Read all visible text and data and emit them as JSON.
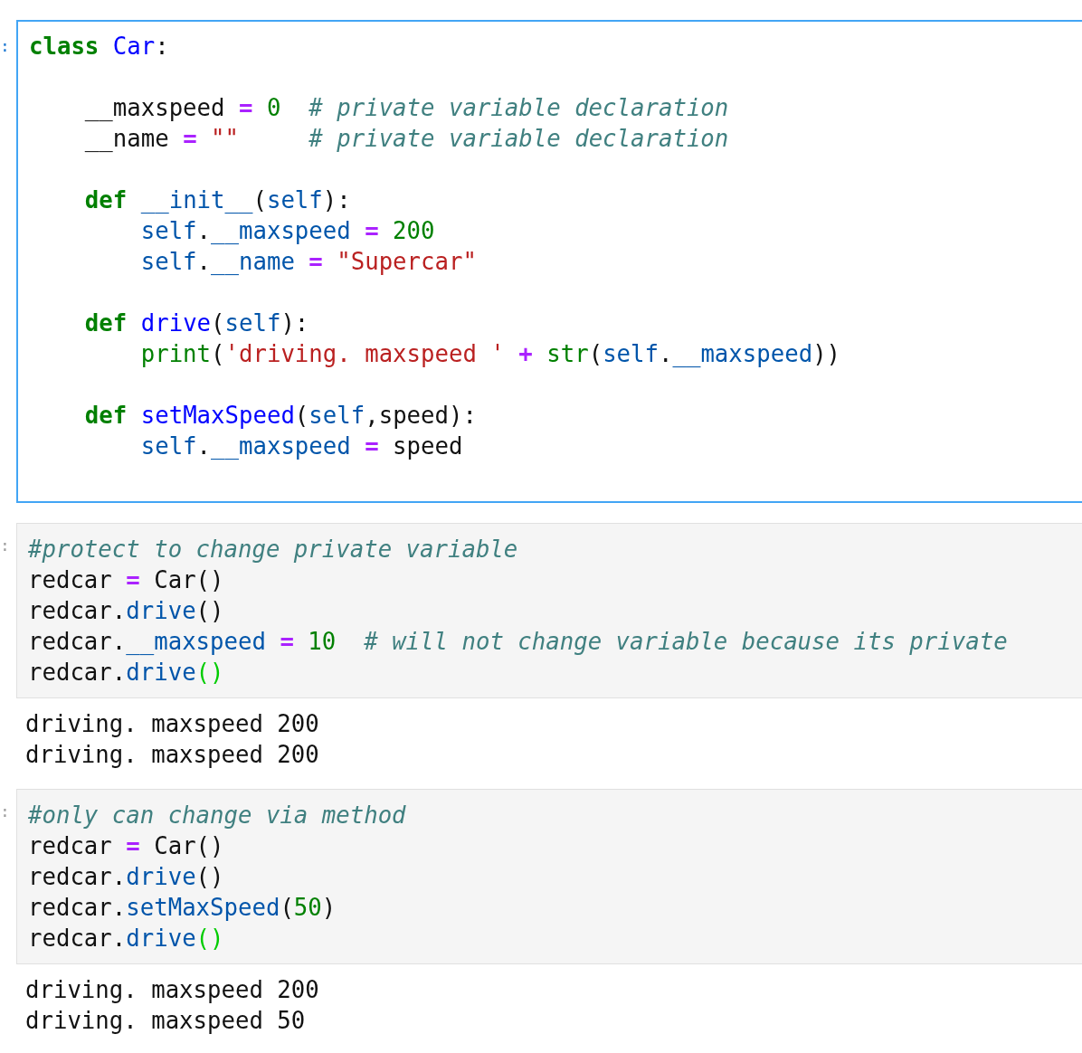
{
  "cells": [
    {
      "prompt": ":",
      "selected": true,
      "blocks": [
        {
          "lines": [
            {
              "tokens": [
                {
                  "kind": "kw",
                  "text": "class"
                },
                {
                  "kind": "def",
                  "text": " Car"
                },
                {
                  "kind": "plain",
                  "text": ":"
                }
              ]
            }
          ]
        },
        {
          "lines": [
            {
              "tokens": [
                {
                  "kind": "plain",
                  "text": "    __maxspeed "
                },
                {
                  "kind": "op",
                  "text": "="
                },
                {
                  "kind": "num",
                  "text": " 0"
                },
                {
                  "kind": "com",
                  "text": "  # private variable declaration"
                }
              ]
            },
            {
              "tokens": [
                {
                  "kind": "plain",
                  "text": "    __name "
                },
                {
                  "kind": "op",
                  "text": "="
                },
                {
                  "kind": "str",
                  "text": " \"\""
                },
                {
                  "kind": "com",
                  "text": "     # private variable declaration"
                }
              ]
            }
          ]
        },
        {
          "lines": [
            {
              "tokens": [
                {
                  "kind": "kw",
                  "text": "    def"
                },
                {
                  "kind": "var",
                  "text": " __init__"
                },
                {
                  "kind": "plain",
                  "text": "("
                },
                {
                  "kind": "var",
                  "text": "self"
                },
                {
                  "kind": "plain",
                  "text": "):"
                }
              ]
            },
            {
              "tokens": [
                {
                  "kind": "var",
                  "text": "        self"
                },
                {
                  "kind": "plain",
                  "text": "."
                },
                {
                  "kind": "var",
                  "text": "__maxspeed"
                },
                {
                  "kind": "op",
                  "text": " ="
                },
                {
                  "kind": "num",
                  "text": " 200"
                }
              ]
            },
            {
              "tokens": [
                {
                  "kind": "var",
                  "text": "        self"
                },
                {
                  "kind": "plain",
                  "text": "."
                },
                {
                  "kind": "var",
                  "text": "__name"
                },
                {
                  "kind": "op",
                  "text": " ="
                },
                {
                  "kind": "str",
                  "text": " \"Supercar\""
                }
              ]
            }
          ]
        },
        {
          "lines": [
            {
              "tokens": [
                {
                  "kind": "kw",
                  "text": "    def"
                },
                {
                  "kind": "def",
                  "text": " drive"
                },
                {
                  "kind": "plain",
                  "text": "("
                },
                {
                  "kind": "var",
                  "text": "self"
                },
                {
                  "kind": "plain",
                  "text": "):"
                }
              ]
            },
            {
              "tokens": [
                {
                  "kind": "builtin",
                  "text": "        print"
                },
                {
                  "kind": "plain",
                  "text": "("
                },
                {
                  "kind": "str",
                  "text": "'driving. maxspeed '"
                },
                {
                  "kind": "op",
                  "text": " +"
                },
                {
                  "kind": "builtin",
                  "text": " str"
                },
                {
                  "kind": "plain",
                  "text": "("
                },
                {
                  "kind": "var",
                  "text": "self"
                },
                {
                  "kind": "plain",
                  "text": "."
                },
                {
                  "kind": "var",
                  "text": "__maxspeed"
                },
                {
                  "kind": "plain",
                  "text": "))"
                }
              ]
            }
          ]
        },
        {
          "lines": [
            {
              "tokens": [
                {
                  "kind": "kw",
                  "text": "    def"
                },
                {
                  "kind": "def",
                  "text": " setMaxSpeed"
                },
                {
                  "kind": "plain",
                  "text": "("
                },
                {
                  "kind": "var",
                  "text": "self"
                },
                {
                  "kind": "plain",
                  "text": ",speed):"
                }
              ]
            },
            {
              "tokens": [
                {
                  "kind": "var",
                  "text": "        self"
                },
                {
                  "kind": "plain",
                  "text": "."
                },
                {
                  "kind": "var",
                  "text": "__maxspeed"
                },
                {
                  "kind": "op",
                  "text": " ="
                },
                {
                  "kind": "plain",
                  "text": " speed"
                }
              ]
            }
          ]
        }
      ]
    },
    {
      "prompt": ":",
      "selected": false,
      "blocks": [
        {
          "lines": [
            {
              "tokens": [
                {
                  "kind": "com",
                  "text": "#protect to change private variable"
                }
              ]
            },
            {
              "tokens": [
                {
                  "kind": "plain",
                  "text": "redcar "
                },
                {
                  "kind": "op",
                  "text": "="
                },
                {
                  "kind": "plain",
                  "text": " Car()"
                }
              ]
            },
            {
              "tokens": [
                {
                  "kind": "plain",
                  "text": "redcar."
                },
                {
                  "kind": "var",
                  "text": "drive"
                },
                {
                  "kind": "plain",
                  "text": "()"
                }
              ]
            },
            {
              "tokens": [
                {
                  "kind": "plain",
                  "text": "redcar."
                },
                {
                  "kind": "var",
                  "text": "__maxspeed"
                },
                {
                  "kind": "op",
                  "text": " ="
                },
                {
                  "kind": "num",
                  "text": " 10"
                },
                {
                  "kind": "com",
                  "text": "  # will not change variable because its private"
                }
              ]
            },
            {
              "tokens": [
                {
                  "kind": "plain",
                  "text": "redcar."
                },
                {
                  "kind": "var",
                  "text": "drive"
                },
                {
                  "kind": "match",
                  "text": "()"
                }
              ]
            }
          ]
        }
      ],
      "output": [
        "driving. maxspeed 200",
        "driving. maxspeed 200"
      ]
    },
    {
      "prompt": ":",
      "selected": false,
      "blocks": [
        {
          "lines": [
            {
              "tokens": [
                {
                  "kind": "com",
                  "text": "#only can change via method"
                }
              ]
            },
            {
              "tokens": [
                {
                  "kind": "plain",
                  "text": "redcar "
                },
                {
                  "kind": "op",
                  "text": "="
                },
                {
                  "kind": "plain",
                  "text": " Car()"
                }
              ]
            },
            {
              "tokens": [
                {
                  "kind": "plain",
                  "text": "redcar."
                },
                {
                  "kind": "var",
                  "text": "drive"
                },
                {
                  "kind": "plain",
                  "text": "()"
                }
              ]
            },
            {
              "tokens": [
                {
                  "kind": "plain",
                  "text": "redcar."
                },
                {
                  "kind": "var",
                  "text": "setMaxSpeed"
                },
                {
                  "kind": "plain",
                  "text": "("
                },
                {
                  "kind": "num",
                  "text": "50"
                },
                {
                  "kind": "plain",
                  "text": ")"
                }
              ]
            },
            {
              "tokens": [
                {
                  "kind": "plain",
                  "text": "redcar."
                },
                {
                  "kind": "var",
                  "text": "drive"
                },
                {
                  "kind": "match",
                  "text": "()"
                }
              ]
            }
          ]
        }
      ],
      "output": [
        "driving. maxspeed 200",
        "driving. maxspeed 50"
      ]
    }
  ]
}
